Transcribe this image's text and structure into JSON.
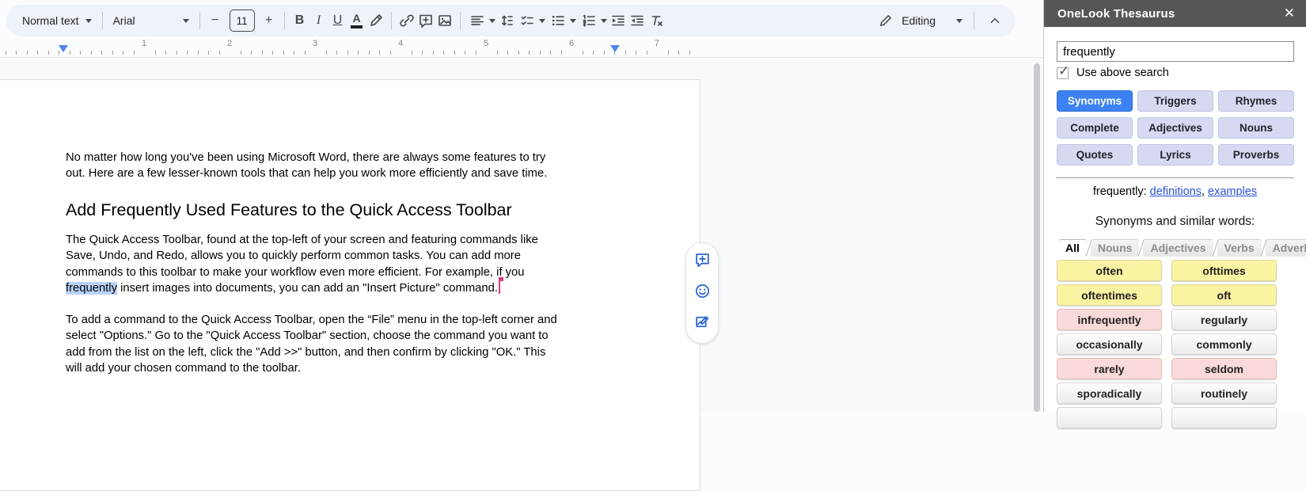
{
  "colors": {
    "accent_blue": "#3c82f4",
    "lavender_button": "#d7d9f2",
    "yellow_cell": "#faf3a2",
    "pink_cell": "#f9d9d9",
    "gray_cell": "#ececec",
    "selection_highlight": "#b9d3fa",
    "collab_caret": "#d93a8c",
    "panel_header_bg": "#565658",
    "link_blue": "#2b50d6",
    "ruler_marker_blue": "#4e86ec"
  },
  "icons": {
    "minus": "−",
    "plus": "+",
    "bold": "B",
    "italic": "I",
    "underline": "U",
    "text_color": "A",
    "check": "✓",
    "close": "✕"
  },
  "toolbar": {
    "style_selector": "Normal text",
    "font_selector": "Arial",
    "font_size": "11",
    "mode_label": "Editing"
  },
  "ruler": {
    "numbers": [
      "1",
      "2",
      "3",
      "4",
      "5",
      "6",
      "7"
    ]
  },
  "document": {
    "para1": {
      "l1": "No matter how long you've been using Microsoft Word, there are always some features to try",
      "l2": "out. Here are a few lesser-known tools that can help you work more efficiently and save time."
    },
    "heading": "Add Frequently Used Features to the Quick Access Toolbar",
    "para2": {
      "l1": "The Quick Access Toolbar, found at the top-left of your screen and featuring commands like",
      "l2": "Save, Undo, and Redo, allows you to quickly perform common tasks. You can add more",
      "l3": "commands to this toolbar to make your workflow even more efficient. For example, if you",
      "l4_highlight": "frequently",
      "l4_rest": " insert images into documents, you can add an \"Insert Picture\" command."
    },
    "para3": {
      "l1": "To add a command to the Quick Access Toolbar, open the “File” menu in the top-left corner and",
      "l2": "select \"Options.\" Go to the \"Quick Access Toolbar\" section, choose the command you want to",
      "l3": "add from the list on the left, click the \"Add >>\" button, and then confirm by clicking \"OK.\" This",
      "l4": "will add your chosen command to the toolbar."
    }
  },
  "panel": {
    "title": "OneLook Thesaurus",
    "search_value": "frequently",
    "checkbox_label": "Use above search",
    "checkbox_checked": true,
    "mode_buttons": [
      {
        "label": "Synonyms",
        "active": true
      },
      {
        "label": "Triggers",
        "active": false
      },
      {
        "label": "Rhymes",
        "active": false
      },
      {
        "label": "Complete",
        "active": false
      },
      {
        "label": "Adjectives",
        "active": false
      },
      {
        "label": "Nouns",
        "active": false
      },
      {
        "label": "Quotes",
        "active": false
      },
      {
        "label": "Lyrics",
        "active": false
      },
      {
        "label": "Proverbs",
        "active": false
      }
    ],
    "entry_word": "frequently:",
    "entry_links": [
      "definitions",
      "examples"
    ],
    "entry_link_separator": ", ",
    "similar_heading": "Synonyms and similar words:",
    "tabs": [
      {
        "label": "All",
        "active": true
      },
      {
        "label": "Nouns",
        "active": false
      },
      {
        "label": "Adjectives",
        "active": false
      },
      {
        "label": "Verbs",
        "active": false
      },
      {
        "label": "Adverbs",
        "active": false
      }
    ],
    "words": [
      {
        "text": "often",
        "color": "yellow"
      },
      {
        "text": "ofttimes",
        "color": "yellow"
      },
      {
        "text": "oftentimes",
        "color": "yellow"
      },
      {
        "text": "oft",
        "color": "yellow"
      },
      {
        "text": "infrequently",
        "color": "pink"
      },
      {
        "text": "regularly",
        "color": "gray"
      },
      {
        "text": "occasionally",
        "color": "gray"
      },
      {
        "text": "commonly",
        "color": "gray"
      },
      {
        "text": "rarely",
        "color": "pink"
      },
      {
        "text": "seldom",
        "color": "pink"
      },
      {
        "text": "sporadically",
        "color": "gray"
      },
      {
        "text": "routinely",
        "color": "gray"
      },
      {
        "text": "",
        "color": "gray"
      },
      {
        "text": "",
        "color": "gray"
      }
    ]
  }
}
